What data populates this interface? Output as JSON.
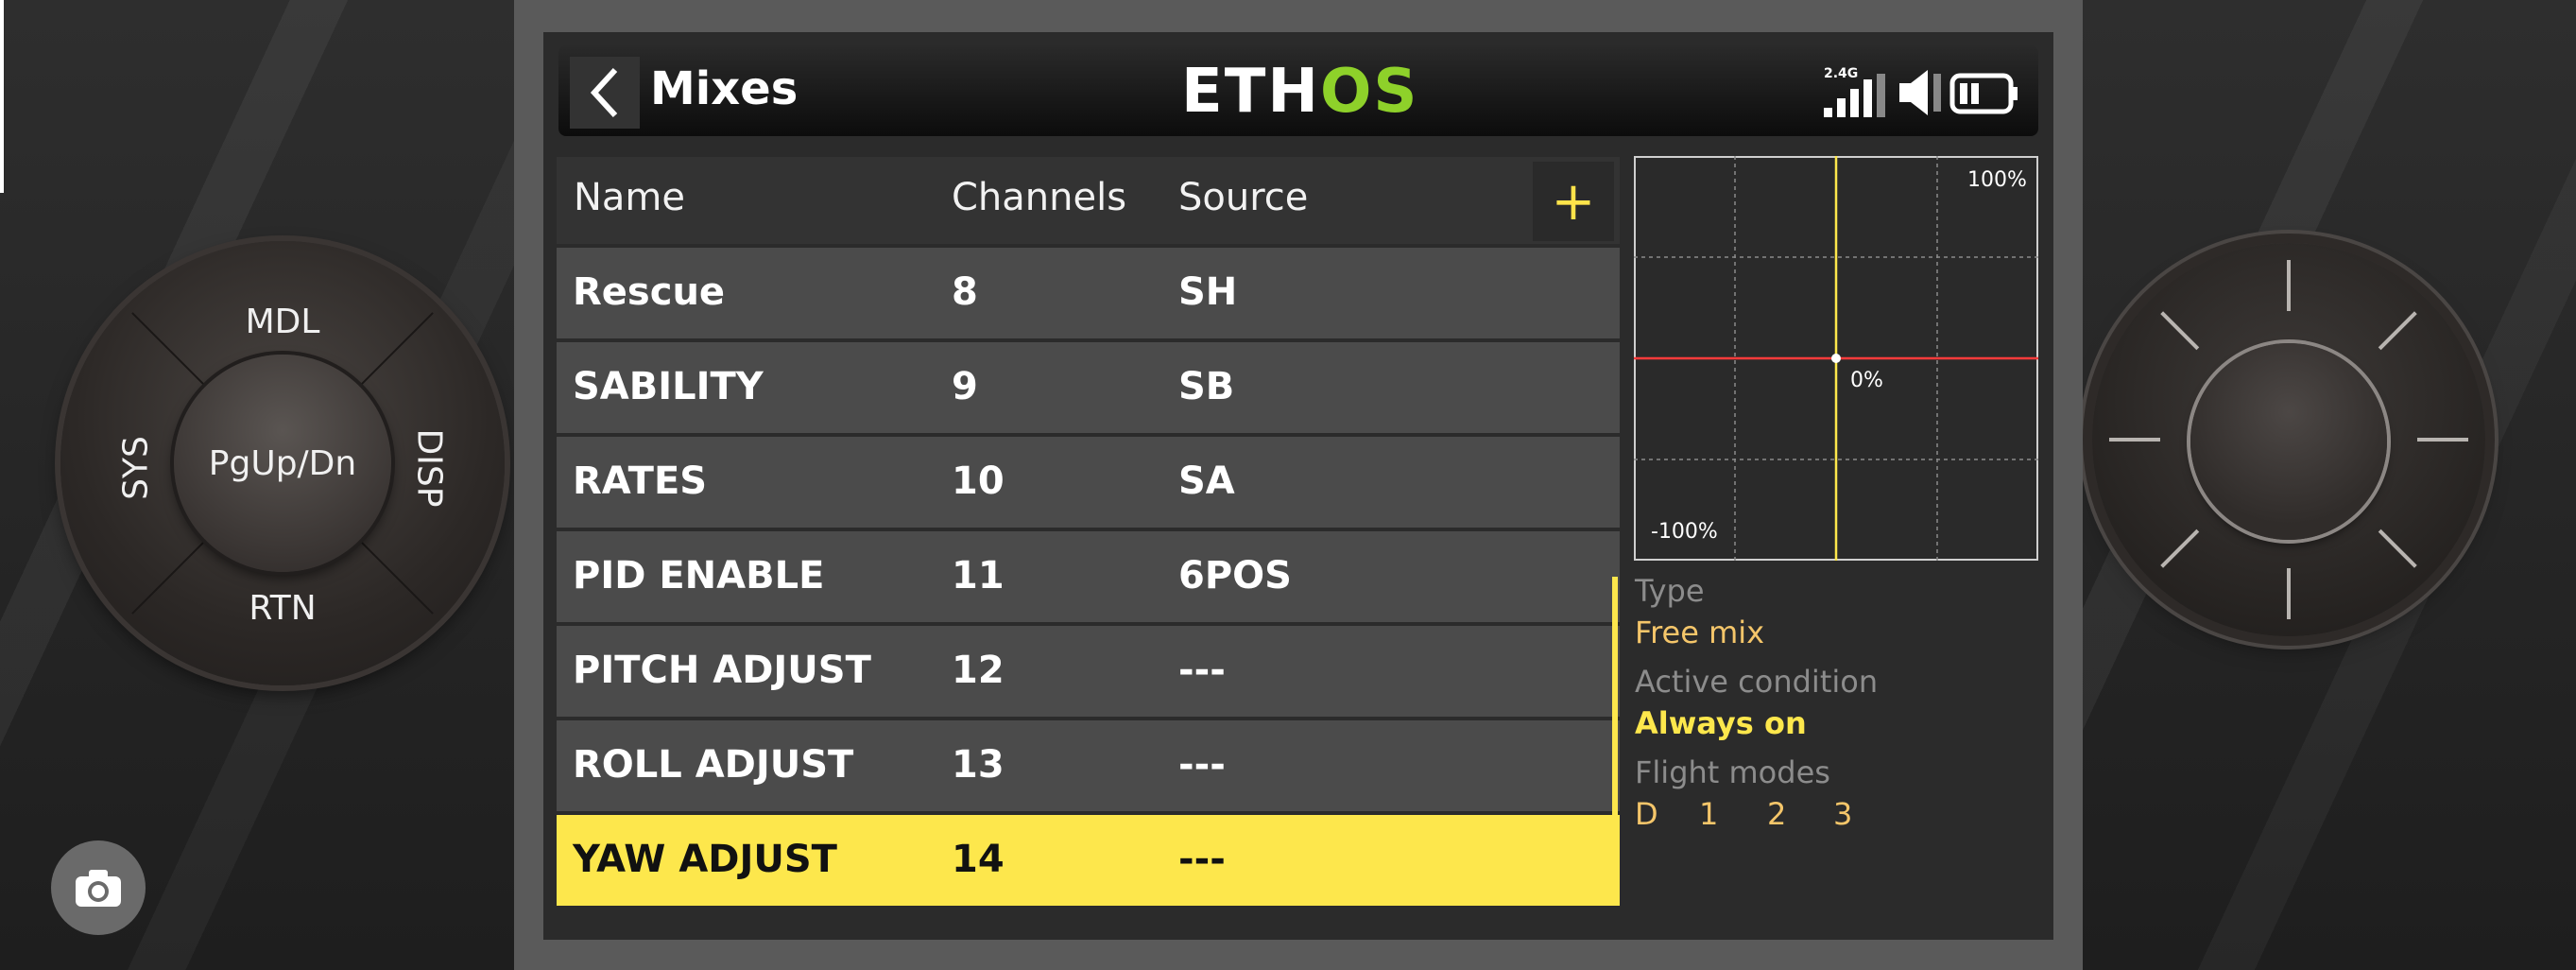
{
  "header": {
    "title": "Mixes",
    "logo_main": "ETH",
    "logo_accent": "OS",
    "signal_label": "2.4G"
  },
  "table": {
    "columns": {
      "name": "Name",
      "channels": "Channels",
      "source": "Source"
    },
    "add_label": "+",
    "rows": [
      {
        "name": "Rescue",
        "channel": "8",
        "source": "SH"
      },
      {
        "name": "SABILITY",
        "channel": "9",
        "source": "SB"
      },
      {
        "name": "RATES",
        "channel": "10",
        "source": "SA"
      },
      {
        "name": "PID ENABLE",
        "channel": "11",
        "source": "6POS"
      },
      {
        "name": "PITCH ADJUST",
        "channel": "12",
        "source": "---"
      },
      {
        "name": "ROLL ADJUST",
        "channel": "13",
        "source": "---"
      },
      {
        "name": "YAW ADJUST",
        "channel": "14",
        "source": "---"
      }
    ],
    "selected_index": 6
  },
  "curve": {
    "top_label": "100%",
    "bottom_label": "-100%",
    "center_label": "0%",
    "colors": {
      "output_line": "#ff3b3b",
      "input_line": "#fde74c",
      "grid": "#8a8a8a"
    }
  },
  "info": {
    "type_label": "Type",
    "type_value": "Free mix",
    "active_condition_label": "Active condition",
    "active_condition_value": "Always on",
    "flight_modes_label": "Flight modes",
    "flight_modes": [
      "D",
      "1",
      "2",
      "3"
    ]
  },
  "controls": {
    "pad_center": "PgUp/Dn",
    "pad_top": "MDL",
    "pad_bottom": "RTN",
    "pad_left": "SYS",
    "pad_right": "DISP"
  },
  "colors": {
    "accent_yellow": "#fde74c",
    "logo_green": "#8ed12a"
  }
}
